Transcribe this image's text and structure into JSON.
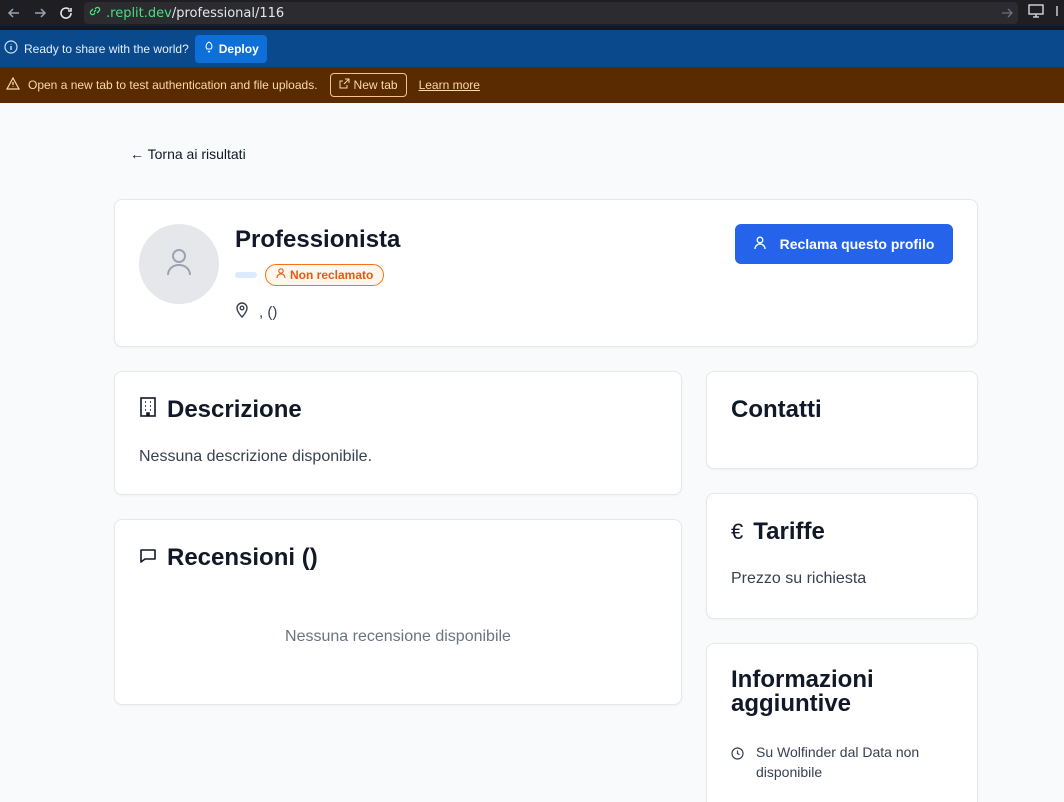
{
  "browser": {
    "url_host": ".replit.dev",
    "url_path": "/professional/116"
  },
  "deploy_bar": {
    "message": "Ready to share with the world?",
    "deploy_label": "Deploy"
  },
  "warn_bar": {
    "message": "Open a new tab to test authentication and file uploads.",
    "new_tab_label": "New tab",
    "learn_more_label": "Learn more"
  },
  "page": {
    "back_label": "← Torna ai risultati"
  },
  "profile": {
    "name": "Professionista",
    "badge_label": "Non reclamato",
    "location": ", ()",
    "claim_label": "Reclama questo profilo"
  },
  "description": {
    "title": "Descrizione",
    "text": "Nessuna descrizione disponibile."
  },
  "reviews": {
    "title": "Recensioni ()",
    "empty_text": "Nessuna recensione disponibile"
  },
  "contacts": {
    "title": "Contatti"
  },
  "rates": {
    "title": "Tariffe",
    "currency_symbol": "€",
    "text": "Prezzo su richiesta"
  },
  "info": {
    "title": "Informazioni aggiuntive",
    "since_text": "Su Wolfinder dal Data non disponibile"
  },
  "colors": {
    "primary": "#2563eb",
    "badge_orange": "#ea580c",
    "deploy_bg": "#0a4a8c",
    "warn_bg": "#5a2a00"
  }
}
